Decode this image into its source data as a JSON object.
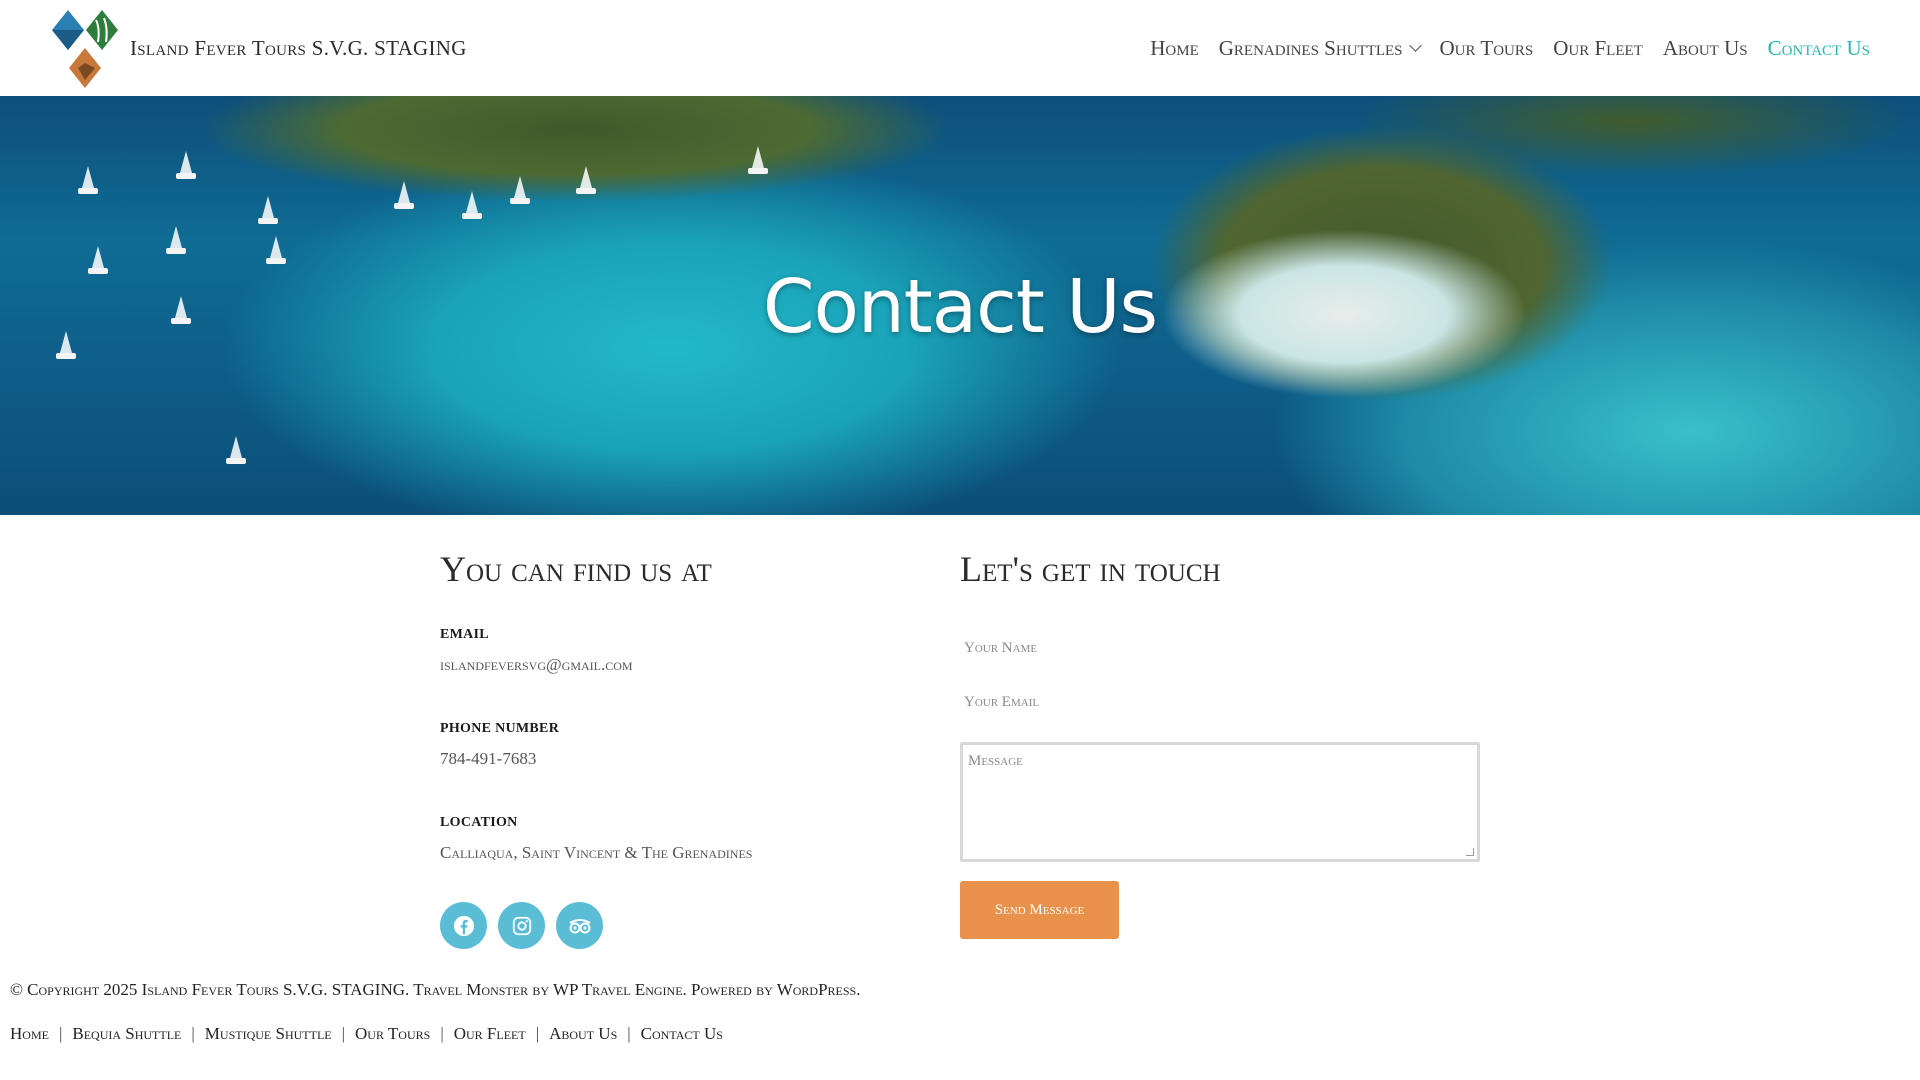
{
  "header": {
    "site_title": "Island Fever Tours S.V.G. STAGING",
    "nav": [
      {
        "label": "Home",
        "active": false
      },
      {
        "label": "Grenadines Shuttles",
        "active": false,
        "has_dropdown": true
      },
      {
        "label": "Our Tours",
        "active": false
      },
      {
        "label": "Our Fleet",
        "active": false
      },
      {
        "label": "About Us",
        "active": false
      },
      {
        "label": "Contact Us",
        "active": true
      }
    ]
  },
  "hero": {
    "title": "Contact Us"
  },
  "contact_info": {
    "heading": "You can find us at",
    "email_label": "EMAIL",
    "email_value": "islandfeversvg@gmail.com",
    "phone_label": "PHONE NUMBER",
    "phone_value": "784-491-7683",
    "location_label": "LOCATION",
    "location_value": "Calliaqua, Saint Vincent & The Grenadines",
    "social": [
      "facebook-icon",
      "instagram-icon",
      "tripadvisor-icon"
    ]
  },
  "contact_form": {
    "heading": "Let's get in touch",
    "name_placeholder": "Your Name",
    "email_placeholder": "Your Email",
    "message_placeholder": "Message",
    "submit_label": "Send Message"
  },
  "footer": {
    "copyright": "© Copyright 2025 Island Fever Tours S.V.G. STAGING. Travel Monster by WP Travel Engine. Powered by WordPress.",
    "links": [
      "Home",
      "Bequia Shuttle",
      "Mustique Shuttle",
      "Our Tours",
      "Our Fleet",
      "About Us",
      "Contact Us"
    ]
  },
  "colors": {
    "accent": "#2bb5b0",
    "button": "#e8914a",
    "social": "#5bbcd6"
  }
}
